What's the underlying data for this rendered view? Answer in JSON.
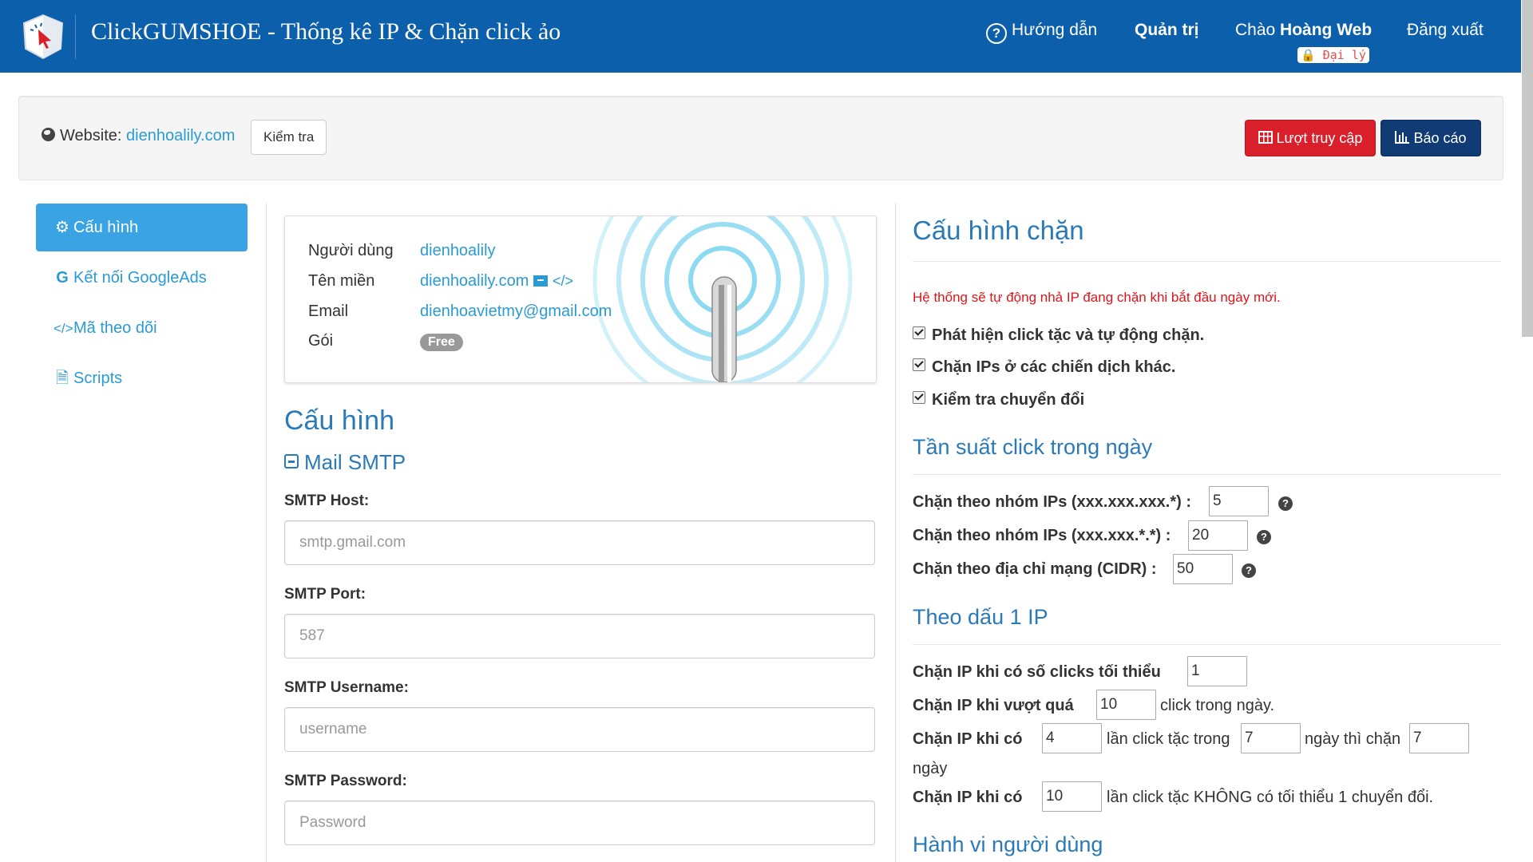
{
  "header": {
    "title": "ClickGUMSHOE - Thống kê IP & Chặn click ảo",
    "help": "Hướng dẫn",
    "admin": "Quản trị",
    "greeting_prefix": "Chào",
    "greeting_name": "Hoàng Web",
    "role_badge": "Đại lý",
    "logout": "Đăng xuất"
  },
  "website_bar": {
    "label": "Website:",
    "domain": "dienhoalily.com",
    "check_button": "Kiểm tra",
    "visits_button": "Lượt truy cập",
    "report_button": "Báo cáo"
  },
  "sidebar": {
    "items": [
      {
        "label": "Cấu hình",
        "icon": "gear-icon",
        "active": true
      },
      {
        "label": "Kết nối GoogleAds",
        "icon": "google-icon"
      },
      {
        "label": "Mã theo dõi",
        "icon": "code-icon"
      },
      {
        "label": "Scripts",
        "icon": "file-code-icon"
      }
    ]
  },
  "profile": {
    "user_label": "Người dùng",
    "user_value": "dienhoalily",
    "domain_label": "Tên miền",
    "domain_value": "dienhoalily.com",
    "email_label": "Email",
    "email_value": "dienhoavietmy@gmail.com",
    "plan_label": "Gói",
    "plan_value": "Free"
  },
  "config": {
    "title": "Cấu hình",
    "smtp_title": "Mail SMTP",
    "host_label": "SMTP Host:",
    "host_placeholder": "smtp.gmail.com",
    "port_label": "SMTP Port:",
    "port_placeholder": "587",
    "username_label": "SMTP Username:",
    "username_placeholder": "username",
    "password_label": "SMTP Password:",
    "password_placeholder": "Password"
  },
  "block_config": {
    "title": "Cấu hình chặn",
    "note": "Hệ thống sẽ tự động nhả IP đang chặn khi bắt đầu ngày mới.",
    "options": [
      {
        "label": "Phát hiện click tặc và tự động chặn.",
        "checked": true
      },
      {
        "label": "Chặn IPs ở các chiến dịch khác.",
        "checked": true
      },
      {
        "label": "Kiểm tra chuyển đổi",
        "checked": true
      }
    ],
    "frequency_title": "Tần suất click trong ngày",
    "group3_label": "Chặn theo nhóm IPs (xxx.xxx.xxx.*) :",
    "group3_value": "5",
    "group2_label": "Chặn theo nhóm IPs (xxx.xxx.*.*) :",
    "group2_value": "20",
    "cidr_label": "Chặn theo địa chỉ mạng (CIDR) :",
    "cidr_value": "50",
    "track_title": "Theo dấu 1 IP",
    "min_clicks_label": "Chặn IP khi có số clicks tối thiểu",
    "min_clicks_value": "1",
    "exceed_label": "Chặn IP khi vượt quá",
    "exceed_value": "10",
    "exceed_suffix": "click trong ngày.",
    "fraud_label": "Chặn IP khi có",
    "fraud_count": "4",
    "fraud_mid": "lần click tặc trong",
    "fraud_days": "7",
    "fraud_then": "ngày thì chặn",
    "fraud_block_days": "7",
    "fraud_unit": "ngày",
    "noconv_label": "Chặn IP khi có",
    "noconv_count": "10",
    "noconv_suffix": "lần click tặc KHÔNG có tối thiểu 1 chuyển đổi.",
    "behavior_title": "Hành vi người dùng"
  }
}
